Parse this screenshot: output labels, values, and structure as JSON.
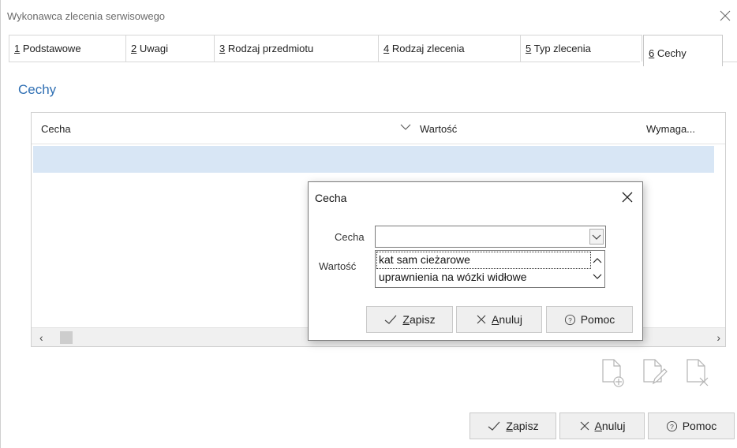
{
  "window": {
    "title": "Wykonawca zlecenia serwisowego"
  },
  "tabs": [
    {
      "num": "1",
      "label": " Podstawowe"
    },
    {
      "num": "2",
      "label": " Uwagi"
    },
    {
      "num": "3",
      "label": " Rodzaj przedmiotu"
    },
    {
      "num": "4",
      "label": " Rodzaj zlecenia"
    },
    {
      "num": "5",
      "label": " Typ zlecenia"
    },
    {
      "num": "6",
      "label": " Cechy"
    }
  ],
  "section_title": "Cechy",
  "grid": {
    "columns": [
      "Cecha",
      "Wartość",
      "Wymaga..."
    ]
  },
  "buttons": {
    "save": {
      "mnemonic": "Z",
      "rest": "apisz"
    },
    "cancel": {
      "mnemonic": "A",
      "rest": "nuluj"
    },
    "help": "Pomoc"
  },
  "dialog": {
    "title": "Cecha",
    "label_cecha": "Cecha",
    "label_wartosc": "Wartość",
    "combo_value": "",
    "options": [
      "kat sam cieżarowe",
      "uprawnienia na wózki widłowe"
    ]
  },
  "icons": [
    "add-document-icon",
    "edit-document-icon",
    "delete-document-icon",
    "close-icon",
    "check-icon",
    "cancel-x-icon",
    "help-icon"
  ]
}
